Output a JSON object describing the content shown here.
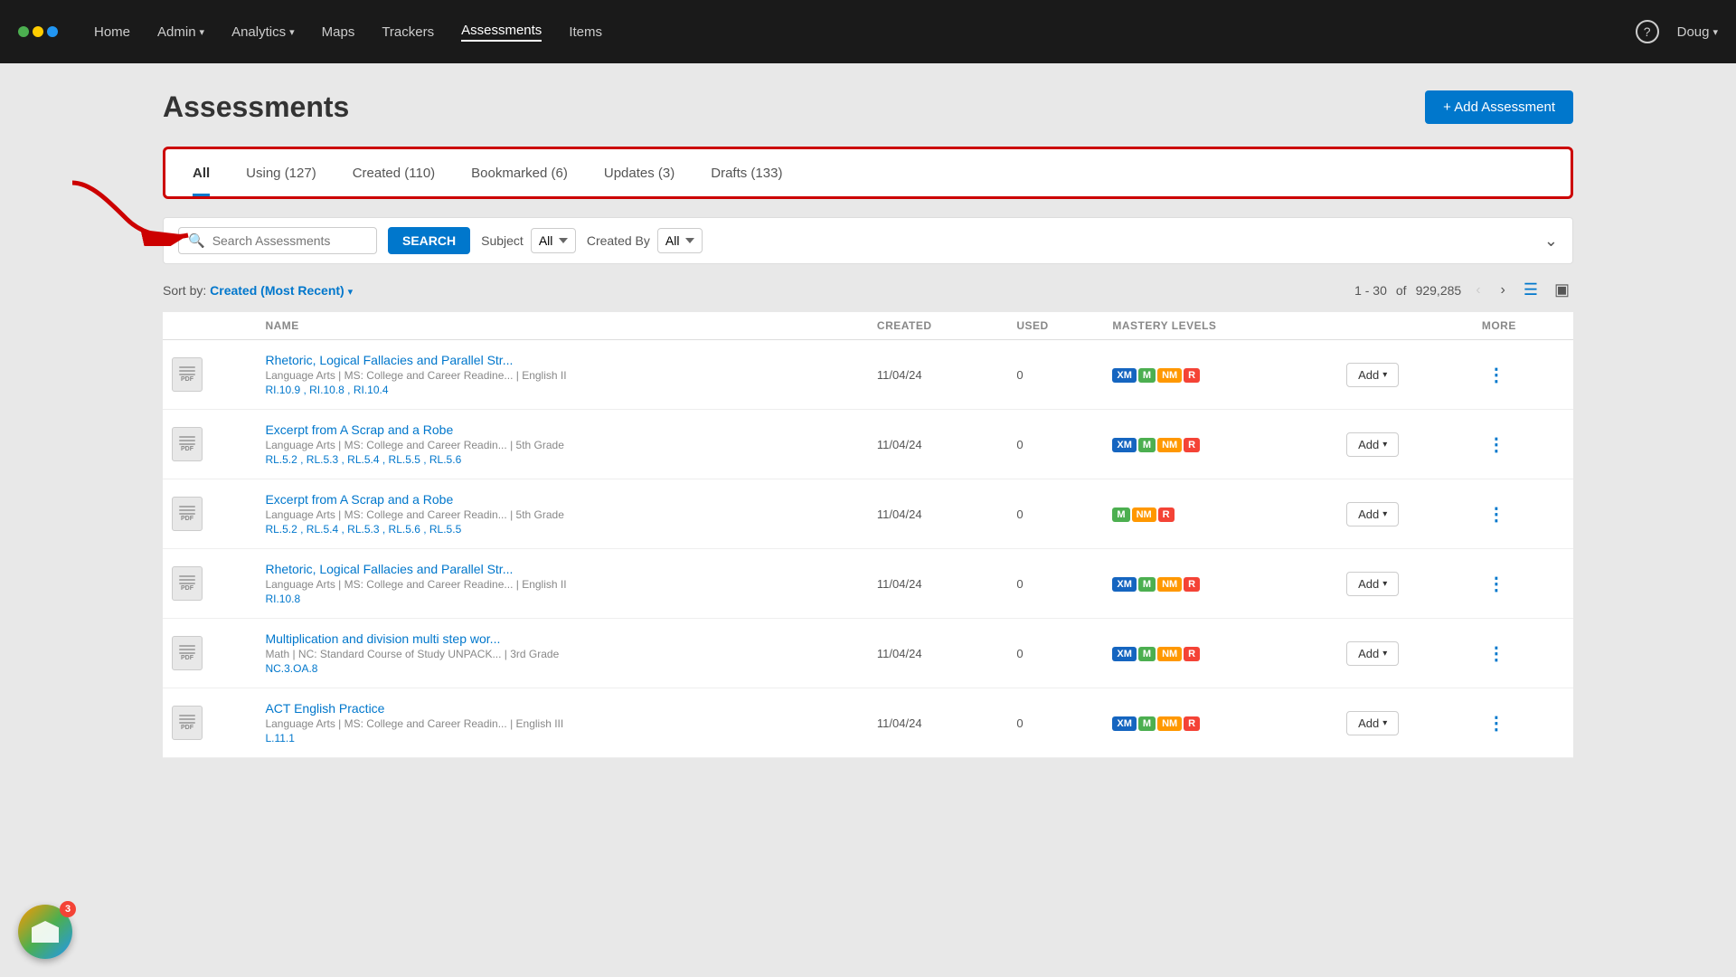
{
  "app": {
    "logo_dots": [
      "green",
      "yellow",
      "blue"
    ]
  },
  "nav": {
    "links": [
      {
        "label": "Home",
        "active": false
      },
      {
        "label": "Admin",
        "has_dropdown": true,
        "active": false
      },
      {
        "label": "Analytics",
        "has_dropdown": true,
        "active": false
      },
      {
        "label": "Maps",
        "has_dropdown": false,
        "active": false
      },
      {
        "label": "Trackers",
        "has_dropdown": false,
        "active": false
      },
      {
        "label": "Assessments",
        "has_dropdown": false,
        "active": true
      },
      {
        "label": "Items",
        "has_dropdown": false,
        "active": false
      }
    ],
    "user": "Doug",
    "help_label": "?"
  },
  "page": {
    "title": "Assessments",
    "add_button": "+ Add Assessment"
  },
  "tabs": [
    {
      "label": "All",
      "active": true
    },
    {
      "label": "Using (127)",
      "active": false
    },
    {
      "label": "Created (110)",
      "active": false
    },
    {
      "label": "Bookmarked (6)",
      "active": false
    },
    {
      "label": "Updates (3)",
      "active": false
    },
    {
      "label": "Drafts (133)",
      "active": false
    }
  ],
  "search": {
    "placeholder": "Search Assessments",
    "button_label": "SEARCH",
    "subject_label": "Subject",
    "subject_value": "All",
    "created_by_label": "Created By",
    "created_by_value": "All"
  },
  "sort": {
    "label": "Sort by:",
    "value": "Created (Most Recent)",
    "pagination_text": "1 - 30",
    "pagination_of": "of",
    "total": "929,285"
  },
  "table": {
    "headers": [
      "",
      "NAME",
      "CREATED",
      "USED",
      "MASTERY LEVELS",
      "",
      "MORE"
    ],
    "rows": [
      {
        "name": "Rhetoric, Logical Fallacies and Parallel Str...",
        "meta": "Language Arts  |  MS: College and Career Readine...  |  English II",
        "standards": "RI.10.9 , RI.10.8 , RI.10.4",
        "created": "11/04/24",
        "used": "0",
        "mastery": [
          "XM",
          "M",
          "NM",
          "R"
        ]
      },
      {
        "name": "Excerpt from A Scrap and a Robe",
        "meta": "Language Arts  |  MS: College and Career Readin...  |  5th Grade",
        "standards": "RL.5.2 , RL.5.3 , RL.5.4 , RL.5.5 , RL.5.6",
        "created": "11/04/24",
        "used": "0",
        "mastery": [
          "XM",
          "M",
          "NM",
          "R"
        ]
      },
      {
        "name": "Excerpt from A Scrap and a Robe",
        "meta": "Language Arts  |  MS: College and Career Readin...  |  5th Grade",
        "standards": "RL.5.2 , RL.5.4 , RL.5.3 , RL.5.6 , RL.5.5",
        "created": "11/04/24",
        "used": "0",
        "mastery": [
          "M",
          "NM",
          "R"
        ]
      },
      {
        "name": "Rhetoric, Logical Fallacies and Parallel Str...",
        "meta": "Language Arts  |  MS: College and Career Readine...  |  English II",
        "standards": "RI.10.8",
        "created": "11/04/24",
        "used": "0",
        "mastery": [
          "XM",
          "M",
          "NM",
          "R"
        ]
      },
      {
        "name": "Multiplication and division multi step wor...",
        "meta": "Math  |  NC: Standard Course of Study UNPACK...  |  3rd Grade",
        "standards": "NC.3.OA.8",
        "created": "11/04/24",
        "used": "0",
        "mastery": [
          "XM",
          "M",
          "NM",
          "R"
        ]
      },
      {
        "name": "ACT English Practice",
        "meta": "Language Arts  |  MS: College and Career Readin...  |  English III",
        "standards": "L.11.1",
        "created": "11/04/24",
        "used": "0",
        "mastery": [
          "XM",
          "M",
          "NM",
          "R"
        ]
      }
    ]
  },
  "widget": {
    "badge_count": "3"
  }
}
